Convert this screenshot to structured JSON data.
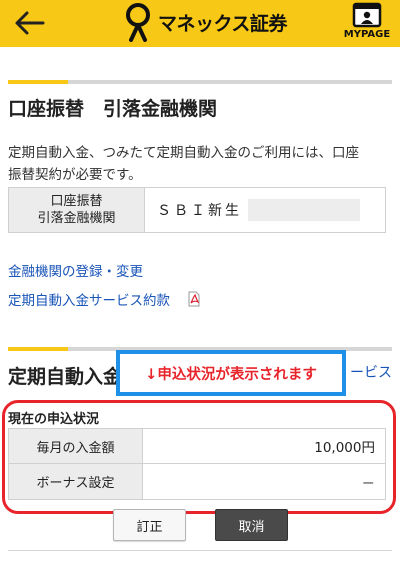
{
  "header": {
    "logo_text": "マネックス証券",
    "mypage_label": "MYPAGE",
    "icons": {
      "back": "back-arrow-icon",
      "logo": "monex-logo-icon",
      "mypage": "mypage-icon"
    },
    "colors": {
      "header_bg": "#f7c815"
    }
  },
  "section1": {
    "title": "口座振替　引落金融機関",
    "notice_line1": "定期自動入金、つみたて定期自動入金のご利用には、口座",
    "notice_line2": "振替契約が必要です。",
    "account_head_line1": "口座振替",
    "account_head_line2": "引落金融機関",
    "account_value": "ＳＢＩ新生",
    "links": {
      "register": "金融機関の登録・変更",
      "terms": "定期自動入金サービス約款"
    },
    "icons": {
      "terms": "pdf-icon"
    }
  },
  "section2": {
    "title": "定期自動入金",
    "behind_text": "ービス",
    "callout_text": "↓申込状況が表示されます",
    "status_label": "現在の申込状況",
    "rows": [
      {
        "label": "毎月の入金額",
        "value": "10,000円"
      },
      {
        "label": "ボーナス設定",
        "value": "－"
      }
    ],
    "buttons": {
      "edit": "訂正",
      "cancel": "取消"
    }
  },
  "colors": {
    "accent_yellow": "#f7c815",
    "callout_border": "#1e90e8",
    "highlight_red": "#e8242b",
    "link_blue": "#1a55b8"
  }
}
